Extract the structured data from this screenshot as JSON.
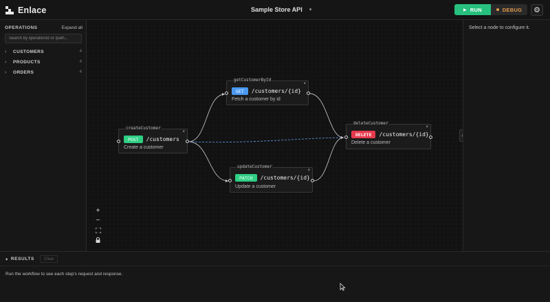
{
  "header": {
    "app_name": "Enlace",
    "api_name": "Sample Store API",
    "run_label": "RUN",
    "debug_label": "DEBUG",
    "icons": {
      "logo": "enlace-logo-icon",
      "api_dropdown": "chevron-down-icon",
      "run": "play-icon",
      "debug": "dot-icon",
      "settings": "gear-icon"
    }
  },
  "sidebar": {
    "title": "OPERATIONS",
    "expand_all": "Expand all",
    "search_placeholder": "Search by operationId or /path...",
    "tags": [
      {
        "name": "CUSTOMERS",
        "count": "4"
      },
      {
        "name": "PRODUCTS",
        "count": "4"
      },
      {
        "name": "ORDERS",
        "count": "4"
      }
    ]
  },
  "canvas": {
    "nodes": [
      {
        "id": "createCustomer",
        "method": "POST",
        "path": "/customers",
        "description": "Create a customer"
      },
      {
        "id": "getCustomerById",
        "method": "GET",
        "path": "/customers/{id}",
        "description": "Fetch a customer by id"
      },
      {
        "id": "updateCustomer",
        "method": "PATCH",
        "path": "/customers/{id}",
        "description": "Update a customer"
      },
      {
        "id": "deleteCustomer",
        "method": "DELETE",
        "path": "/customers/{id}",
        "description": "Delete a customer"
      }
    ],
    "edges": [
      {
        "from": "createCustomer",
        "to": "getCustomerById",
        "style": "solid"
      },
      {
        "from": "createCustomer",
        "to": "updateCustomer",
        "style": "solid"
      },
      {
        "from": "getCustomerById",
        "to": "deleteCustomer",
        "style": "solid"
      },
      {
        "from": "updateCustomer",
        "to": "deleteCustomer",
        "style": "solid"
      },
      {
        "from": "createCustomer",
        "to": "deleteCustomer",
        "style": "dashed"
      }
    ],
    "close_glyph": "×",
    "zoom_controls": [
      "zoom-in-icon",
      "zoom-out-icon",
      "fit-view-icon",
      "lock-icon"
    ]
  },
  "right_panel": {
    "hint": "Select a node to configure it.",
    "collapse_glyph": "›"
  },
  "results": {
    "title": "RESULTS",
    "caret": "▾",
    "clear_label": "Clear",
    "message": "Run the workflow to see each step's request and response."
  },
  "colors": {
    "accent_green": "#27c07e",
    "get_blue": "#4a98f0",
    "delete_red": "#e63a4c",
    "debug_orange": "#e49a4a",
    "dashed_edge": "#5b8fd8"
  }
}
